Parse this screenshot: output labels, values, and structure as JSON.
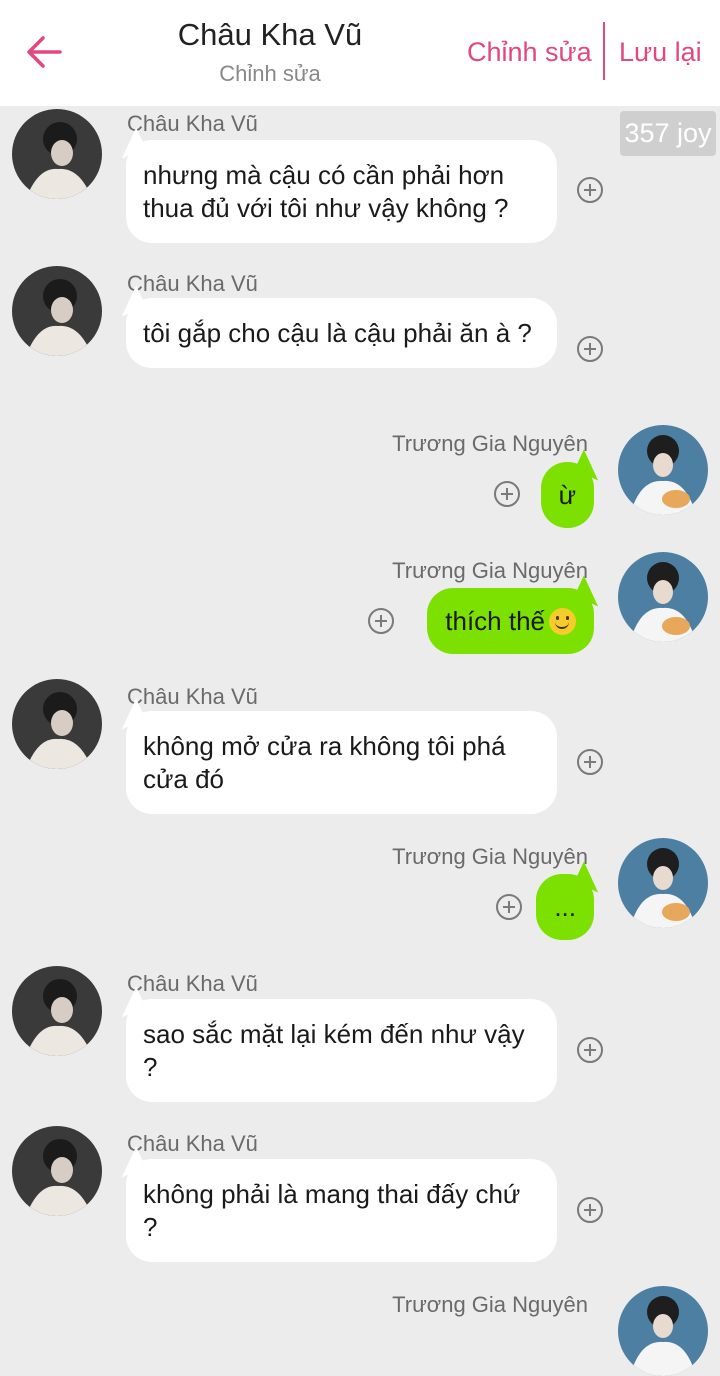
{
  "header": {
    "title": "Châu Kha Vũ",
    "subtitle": "Chỉnh sửa",
    "edit_label": "Chỉnh sửa",
    "save_label": "Lưu lại"
  },
  "counter": "357 joy",
  "messages": [
    {
      "sender": "Châu Kha Vũ",
      "text": "nhưng mà cậu có cần phải hơn thua đủ với tôi như vậy không ?"
    },
    {
      "sender": "Châu Kha Vũ",
      "text": "tôi gắp cho cậu là cậu phải ăn à ?"
    },
    {
      "sender": "Trương Gia Nguyên",
      "text": "ừ"
    },
    {
      "sender": "Trương Gia Nguyên",
      "text": "thích thế",
      "emoji": "slightly-smiling-face-icon"
    },
    {
      "sender": "Châu Kha Vũ",
      "text": "không mở cửa ra không tôi phá cửa đó"
    },
    {
      "sender": "Trương Gia Nguyên",
      "text": "..."
    },
    {
      "sender": "Châu Kha Vũ",
      "text": "sao sắc mặt lại kém đến như vậy ?"
    },
    {
      "sender": "Châu Kha Vũ",
      "text": "không phải là mang thai đấy chứ ?"
    },
    {
      "sender": "Trương Gia Nguyên",
      "text": ""
    }
  ],
  "colors": {
    "accent": "#e4467e",
    "sent_bubble": "#7ce000",
    "received_bubble": "#ffffff",
    "background": "#ececec"
  }
}
